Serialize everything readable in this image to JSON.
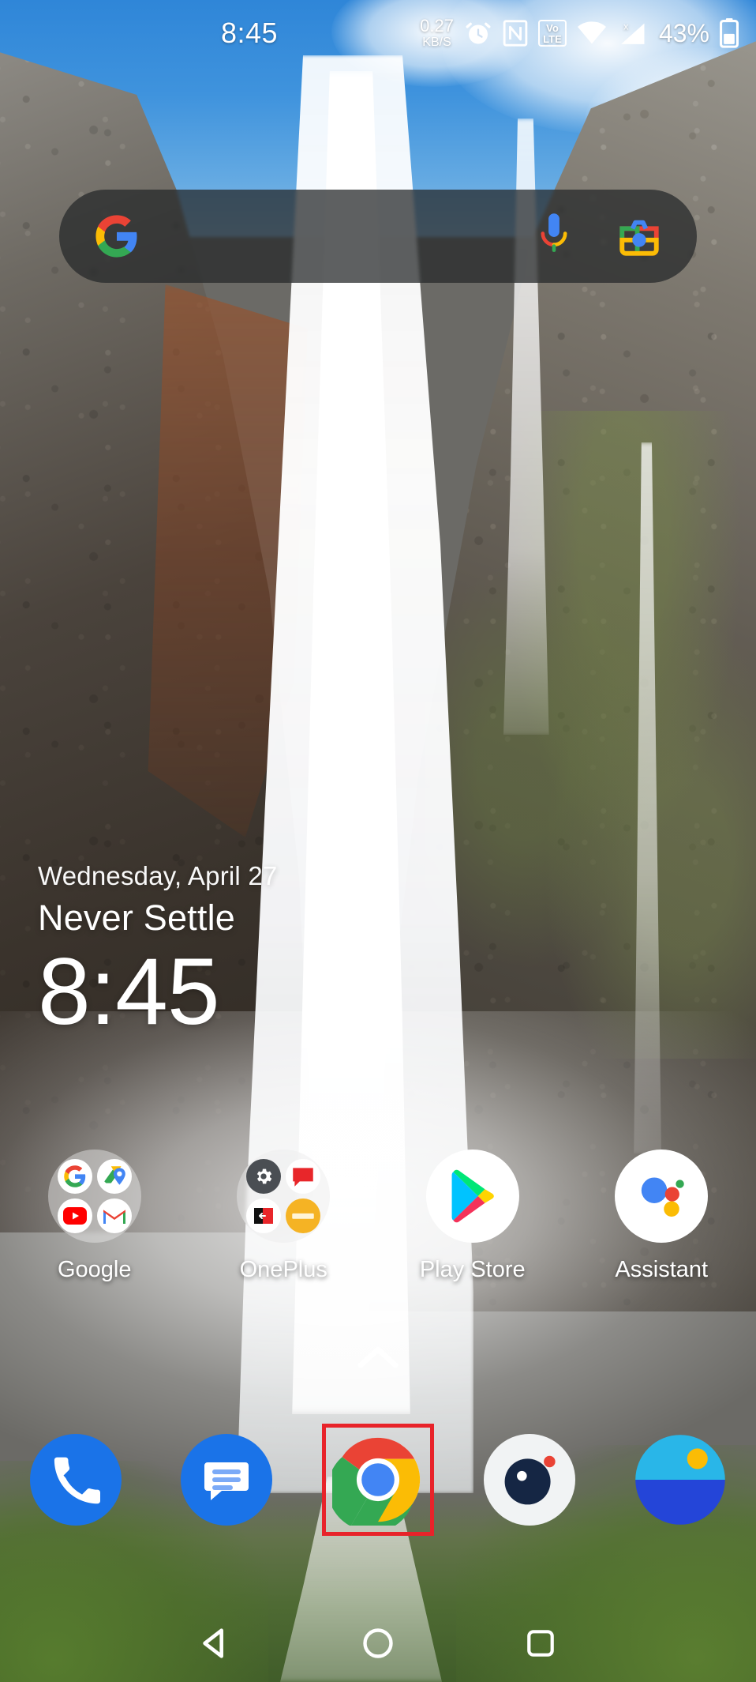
{
  "status_bar": {
    "time": "8:45",
    "network_speed_value": "0.27",
    "network_speed_unit": "KB/S",
    "alarm_icon": "alarm-clock-icon",
    "nfc_icon": "nfc-icon",
    "volte_top": "Vo",
    "volte_bottom": "LTE",
    "wifi_icon": "wifi-icon",
    "signal_icon": "cellular-signal-no-sim-icon",
    "battery_percent": "43%",
    "battery_icon": "battery-icon"
  },
  "search": {
    "placeholder": "",
    "value": "",
    "google_logo": "google-g-icon",
    "mic_icon": "microphone-icon",
    "lens_icon": "google-lens-camera-icon"
  },
  "clock_widget": {
    "date": "Wednesday, April 27",
    "subtitle": "Never Settle",
    "time": "8:45"
  },
  "app_grid": [
    {
      "label": "Google",
      "type": "folder",
      "icon_name": "folder-google",
      "contents": [
        "google-g-icon",
        "google-maps-icon",
        "youtube-icon",
        "gmail-icon"
      ]
    },
    {
      "label": "OnePlus",
      "type": "folder",
      "icon_name": "folder-oneplus",
      "contents": [
        "settings-gear-icon",
        "oneplus-community-icon",
        "clone-phone-icon",
        "zen-mode-icon"
      ]
    },
    {
      "label": "Play Store",
      "type": "app",
      "icon_name": "play-store-icon"
    },
    {
      "label": "Assistant",
      "type": "app",
      "icon_name": "google-assistant-icon"
    }
  ],
  "drawer": {
    "chevron_icon": "chevron-up-icon"
  },
  "dock": [
    {
      "label": "Phone",
      "icon_name": "phone-icon",
      "highlighted": false
    },
    {
      "label": "Messages",
      "icon_name": "messages-icon",
      "highlighted": false
    },
    {
      "label": "Chrome",
      "icon_name": "chrome-icon",
      "highlighted": true
    },
    {
      "label": "Camera",
      "icon_name": "camera-icon",
      "highlighted": false
    },
    {
      "label": "Gallery",
      "icon_name": "gallery-icon",
      "highlighted": false
    }
  ],
  "nav_bar": {
    "back": "back-triangle-icon",
    "home": "home-circle-icon",
    "recents": "recents-square-icon"
  },
  "colors": {
    "highlight": "#e8232a",
    "search_bar_bg": "rgba(38,40,42,0.74)",
    "google_blue": "#4285F4",
    "google_red": "#EA4335",
    "google_yellow": "#FBBC05",
    "google_green": "#34A853",
    "phone_blue": "#1a73e8",
    "gallery_sky": "#29b6e8",
    "gallery_sea": "#2445d8",
    "zen_orange": "#f5b324"
  }
}
